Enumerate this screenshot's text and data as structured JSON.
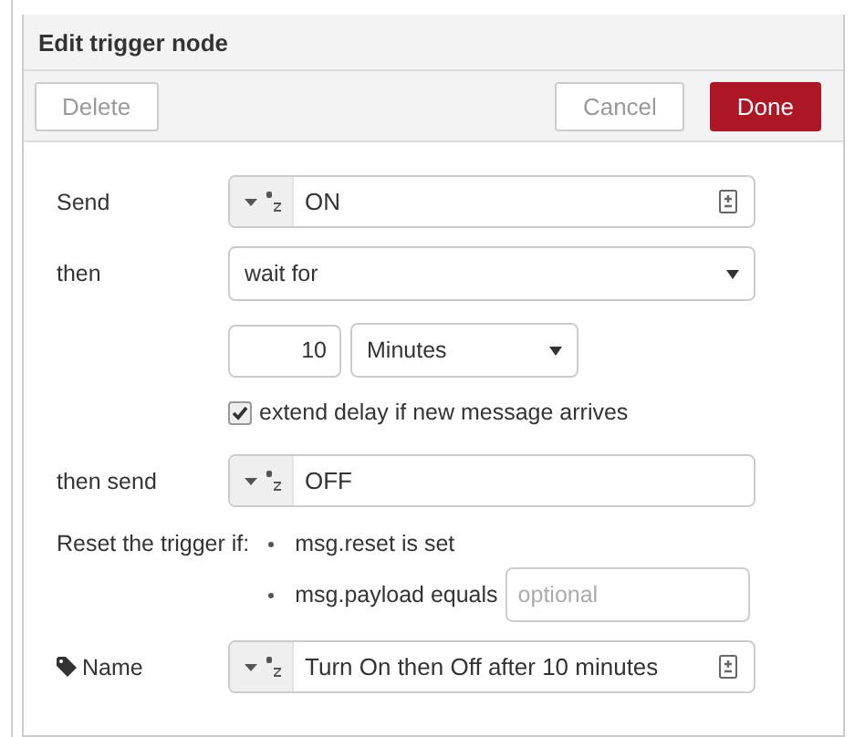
{
  "title": "Edit trigger node",
  "buttons": [
    {
      "label": "Delete",
      "kind": "plain"
    },
    {
      "label": "Cancel",
      "kind": "plain"
    },
    {
      "label": "Done",
      "kind": "primary"
    }
  ],
  "send": {
    "label": "Send",
    "value": "ON"
  },
  "then": {
    "label": "then",
    "value": "wait for"
  },
  "delay": {
    "value": "10",
    "units": "Minutes"
  },
  "extend": {
    "label": "extend delay if new message arrives",
    "checked": true
  },
  "then_send": {
    "label": "then send",
    "value": "OFF"
  },
  "reset": {
    "label": "Reset the trigger if:",
    "conditions": [
      "msg.reset is set",
      "msg.payload equals"
    ],
    "placeholder": "optional"
  },
  "name": {
    "label": "Name",
    "value": "Turn On then Off after 10 minutes"
  }
}
